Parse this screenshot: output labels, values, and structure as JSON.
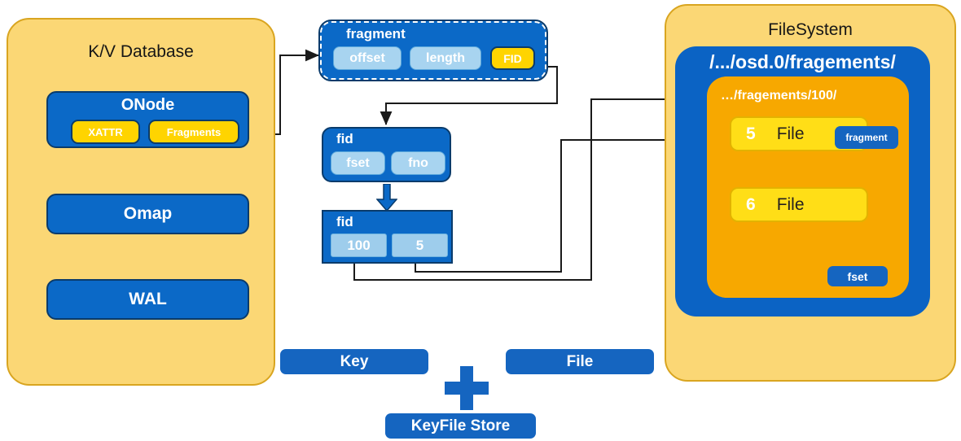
{
  "kv_panel": {
    "title": "K/V Database",
    "onode": {
      "title": "ONode",
      "chips": [
        {
          "label": "XATTR",
          "name": "xattr-chip"
        },
        {
          "label": "Fragments",
          "name": "fragments-chip"
        }
      ]
    },
    "omap": "Omap",
    "wal": "WAL"
  },
  "fragment_struct": {
    "title": "fragment",
    "fields": [
      {
        "label": "offset",
        "name": "fragment-offset-field"
      },
      {
        "label": "length",
        "name": "fragment-length-field"
      },
      {
        "label": "FID",
        "name": "fragment-fid-field"
      }
    ]
  },
  "fid_struct": {
    "title": "fid",
    "fields": [
      {
        "label": "fset",
        "name": "fid-fset-field"
      },
      {
        "label": "fno",
        "name": "fid-fno-field"
      }
    ]
  },
  "fid_values": {
    "title": "fid",
    "fields": [
      {
        "label": "100",
        "name": "fid-fset-value"
      },
      {
        "label": "5",
        "name": "fid-fno-value"
      }
    ]
  },
  "filesystem_panel": {
    "title": "FileSystem",
    "root_path": "/.../osd.0/fragements/",
    "dir_path": "…/fragements/100/",
    "files": [
      {
        "num": "5",
        "word": "File",
        "badge": "fragment"
      },
      {
        "num": "6",
        "word": "File",
        "badge": null
      }
    ],
    "fset_badge": "fset"
  },
  "legend": {
    "key": "Key",
    "file": "File",
    "plus": "+",
    "store": "KeyFile Store"
  },
  "colors": {
    "panel_fill": "#FBD775",
    "panel_border": "#D9A520",
    "blue": "#0B69C7",
    "blue_dark": "#0A3B6B",
    "yellow_chip": "#FFD400",
    "light_blue_chip": "#A8D4F0",
    "orange": "#F7A800",
    "file_yellow": "#FFDE17",
    "wire": "#1a1a1a"
  }
}
